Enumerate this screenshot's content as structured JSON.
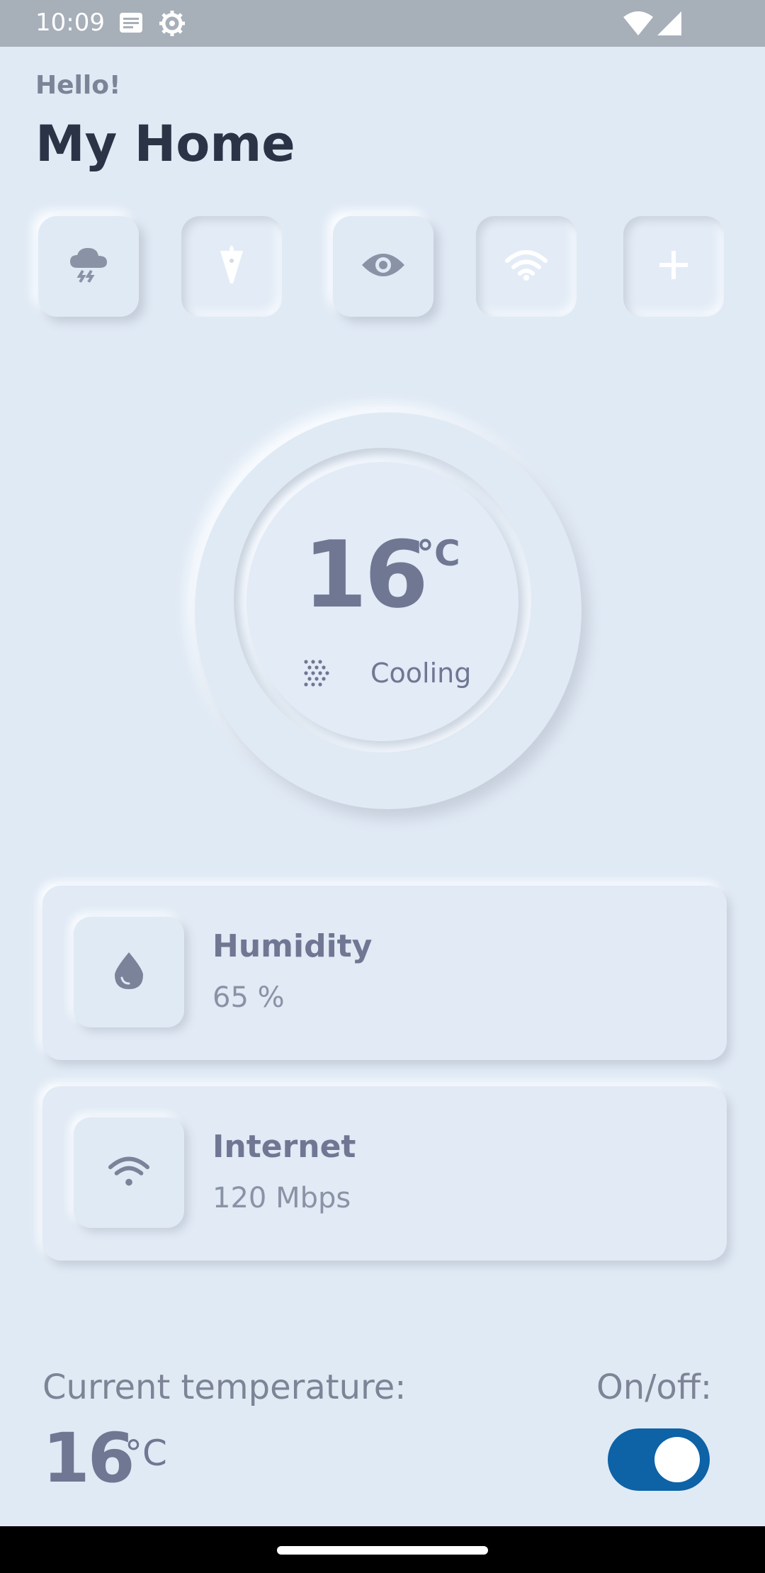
{
  "status_bar": {
    "time": "10:09",
    "icons": [
      "notes-icon",
      "settings-icon",
      "wifi-icon",
      "signal-icon"
    ]
  },
  "header": {
    "greeting": "Hello!",
    "title": "My Home"
  },
  "quick_actions": [
    {
      "icon": "storm-cloud-icon"
    },
    {
      "icon": "torch-icon"
    },
    {
      "icon": "eye-icon"
    },
    {
      "icon": "wifi-icon"
    },
    {
      "icon": "plus-icon"
    }
  ],
  "thermostat": {
    "temperature": "16",
    "unit": "°C",
    "mode": "Cooling",
    "mode_icon": "dots-grid-icon"
  },
  "cards": [
    {
      "title": "Humidity",
      "value": "65 %",
      "icon": "water-drop-icon"
    },
    {
      "title": "Internet",
      "value": "120 Mbps",
      "icon": "wifi-icon"
    }
  ],
  "footer": {
    "current_label": "Current temperature:",
    "current_temp": "16",
    "current_unit": "°C",
    "onoff_label": "On/off:",
    "toggle_on": true
  },
  "colors": {
    "background": "#E0EAF5",
    "accent": "#0E62A6",
    "text_primary": "#2B3446",
    "text_muted": "#6F7793"
  }
}
